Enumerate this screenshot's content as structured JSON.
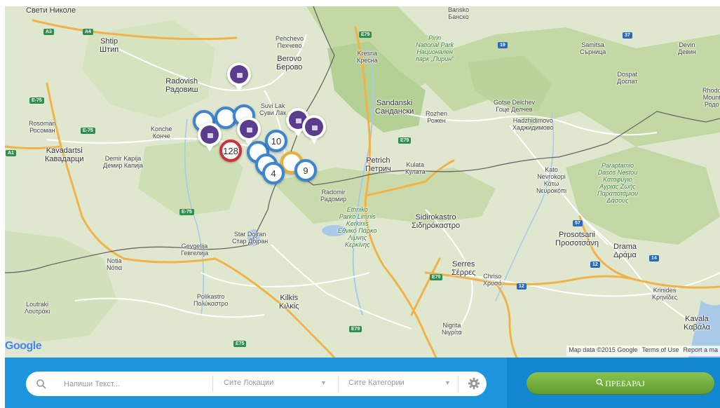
{
  "map": {
    "labels": [
      {
        "text": "Свети Николе"
      },
      {
        "text": "Shtip\nШтип"
      },
      {
        "text": "Radovish\nРадовиш"
      },
      {
        "text": "Pehchevo\nПехчево"
      },
      {
        "text": "Berovo\nБерово"
      },
      {
        "text": "Kresna\nКресна"
      },
      {
        "text": "Pirin\nNational Park\nНационален\nпарк „Пирин“"
      },
      {
        "text": "Bansko\nБанско"
      },
      {
        "text": "Samitsa\nСърница"
      },
      {
        "text": "Devin\nДевин"
      },
      {
        "text": "Dospat\nДоспат"
      },
      {
        "text": "Rhodo\nMount\nРодо"
      },
      {
        "text": "Sandanski\nСандански"
      },
      {
        "text": "Rozhen\nРожен"
      },
      {
        "text": "Gotse Delchev\nГоце Делчев"
      },
      {
        "text": "Hadzhidimovo\nХаджидимово"
      },
      {
        "text": "Rosoman\nРосоман"
      },
      {
        "text": "Konche\nКонче"
      },
      {
        "text": "Kavadartsi\nКавадарци"
      },
      {
        "text": "Demir Kapija\nДемир Капија"
      },
      {
        "text": "Suvi Lak\nСуви Лак"
      },
      {
        "text": "Petrich\nПетрич"
      },
      {
        "text": "Kulata\nКулата"
      },
      {
        "text": "Radomir\nРадомир"
      },
      {
        "text": "Kato\nNevrokopi\nΚάτω\nΝευροκόπι"
      },
      {
        "text": "Paraptamio\nDasos Nestou\nΚαταφύγιο\nΑγριας Ζωής\nΠαραποτάμιου\nΔάσους"
      },
      {
        "text": "Ethniko\nParko Limnis\nKerkinis\nΕθνικό Πάρκο\nΛίμνης\nΚερκίνης"
      },
      {
        "text": "Sidirokastro\nΣιδηρόκαστρο"
      },
      {
        "text": "Star Dojran\nСтар Дојран"
      },
      {
        "text": "Gevgelija\nГевгелија"
      },
      {
        "text": "Notia\nΝότια"
      },
      {
        "text": "Prosotsani\nΠροσοτσάνη"
      },
      {
        "text": "Drama\nΔράμα"
      },
      {
        "text": "Serres\nΣέρρες"
      },
      {
        "text": "Chriso\nΧρυσό"
      },
      {
        "text": "Krinides\nΚρηνίδες"
      },
      {
        "text": "Polikastro\nΠολύκαστρο"
      },
      {
        "text": "Kilkis\nΚιλκίς"
      },
      {
        "text": "Loutraki\nΛουτράκι"
      },
      {
        "text": "Nigrita\nΝιγρίτα"
      },
      {
        "text": "Kavala\nΚαβάλα"
      }
    ],
    "shields": [
      {
        "text": "A3"
      },
      {
        "text": "A4"
      },
      {
        "text": "E79"
      },
      {
        "text": "19"
      },
      {
        "text": "37"
      },
      {
        "text": "E-75"
      },
      {
        "text": "E-75"
      },
      {
        "text": "A1"
      },
      {
        "text": "E79"
      },
      {
        "text": "E-75"
      },
      {
        "text": "57"
      },
      {
        "text": "12"
      },
      {
        "text": "14"
      },
      {
        "text": "E79"
      },
      {
        "text": "12"
      },
      {
        "text": "E79"
      },
      {
        "text": "E75"
      }
    ],
    "clusters": [
      {
        "count": "10"
      },
      {
        "count": "4"
      },
      {
        "count": "9"
      },
      {
        "count": "128"
      }
    ],
    "google_logo": "Google",
    "attribution": [
      "Map data ©2015 Google",
      "Terms of Use",
      "Report a ma"
    ],
    "colors": {
      "land": "#dfe8cf",
      "forest": "#bfd6a0",
      "mountain": "#c7d7ad",
      "water": "#a9c9e9",
      "highway": "#f2b24a",
      "road": "#ffffff",
      "border": "#666666",
      "pin_purple": "#5a3d8c",
      "cluster_blue": "#3d86cf"
    }
  },
  "searchbar": {
    "text_placeholder": "Напиши Текст...",
    "locations_select": "Сите Локации",
    "categories_select": "Сите Категории",
    "search_button_label": "ПРЕБАРАЈ",
    "colors": {
      "bar": "#1c95dd",
      "button": "#6aa93a"
    }
  }
}
